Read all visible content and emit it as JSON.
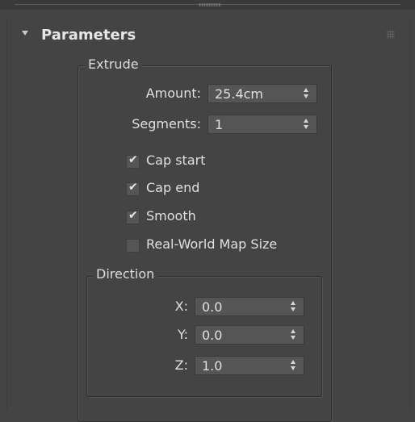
{
  "rollout": {
    "title": "Parameters"
  },
  "extrude": {
    "group_label": "Extrude",
    "amount": {
      "label": "Amount:",
      "value": "25.4cm"
    },
    "segments": {
      "label": "Segments:",
      "value": "1"
    },
    "cap_start": {
      "label": "Cap start",
      "checked": true
    },
    "cap_end": {
      "label": "Cap end",
      "checked": true
    },
    "smooth": {
      "label": "Smooth",
      "checked": true
    },
    "real_world": {
      "label": "Real-World Map Size",
      "checked": false
    }
  },
  "direction": {
    "group_label": "Direction",
    "x": {
      "label": "X:",
      "value": "0.0"
    },
    "y": {
      "label": "Y:",
      "value": "0.0"
    },
    "z": {
      "label": "Z:",
      "value": "1.0"
    }
  },
  "icons": {
    "collapse": "triangle-down-icon",
    "grip": "drag-grip-icon",
    "spinner": "spinner-arrows-icon",
    "check": "checkmark-icon"
  }
}
